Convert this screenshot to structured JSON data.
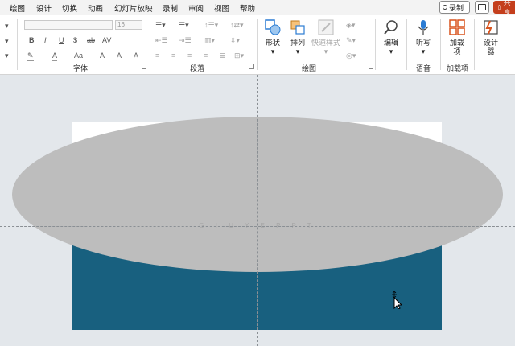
{
  "tabs": [
    "绘图",
    "设计",
    "切换",
    "动画",
    "幻灯片放映",
    "录制",
    "审阅",
    "视图",
    "帮助"
  ],
  "record_label": "录制",
  "share_label": "共享",
  "font_group": {
    "label": "字体",
    "font_size": "16",
    "row2": [
      "B",
      "I",
      "U",
      "$",
      "ab",
      "AV"
    ],
    "row3": [
      "A",
      "A",
      "Aa",
      "A",
      "A",
      "A"
    ]
  },
  "paragraph_group": {
    "label": "段落"
  },
  "drawing_group": {
    "label": "绘图",
    "shapes_label": "形状",
    "arrange_label": "排列",
    "quick_styles_label": "快速样式"
  },
  "editing": {
    "label": "编辑"
  },
  "voice_group": {
    "label": "语音",
    "dictate_label": "听写"
  },
  "addins_group": {
    "label": "加载项",
    "button_label": "加载项"
  },
  "designer": {
    "label": "设计器"
  },
  "slide": {
    "watermark_text": "G I U Y E P P T"
  },
  "colors": {
    "accent": "#18607f",
    "ellipse": "#bdbdbd",
    "canvas": "#e3e7eb",
    "share": "#c43e1c"
  }
}
